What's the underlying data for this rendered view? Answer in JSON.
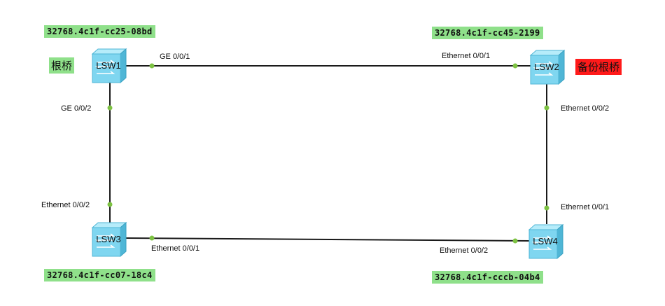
{
  "switches": {
    "lsw1": {
      "label": "LSW1",
      "mac": "32768.4c1f-cc25-08bd",
      "role": "根桥"
    },
    "lsw2": {
      "label": "LSW2",
      "mac": "32768.4c1f-cc45-2199",
      "role": "备份根桥"
    },
    "lsw3": {
      "label": "LSW3",
      "mac": "32768.4c1f-cc07-18c4"
    },
    "lsw4": {
      "label": "LSW4",
      "mac": "32768.4c1f-cccb-04b4"
    }
  },
  "ports": {
    "lsw1_right": "GE 0/0/1",
    "lsw1_down": "GE 0/0/2",
    "lsw2_left": "Ethernet 0/0/1",
    "lsw2_down": "Ethernet 0/0/2",
    "lsw3_up": "Ethernet 0/0/2",
    "lsw3_right": "Ethernet 0/0/1",
    "lsw4_up": "Ethernet 0/0/1",
    "lsw4_left": "Ethernet 0/0/2"
  },
  "colors": {
    "root_tag": "#8fe08a",
    "backup_tag": "#ff1a1a",
    "mac_tag": "#8fe08a",
    "port_dot": "#7dc242",
    "switch_body": "#7fd6f0"
  }
}
